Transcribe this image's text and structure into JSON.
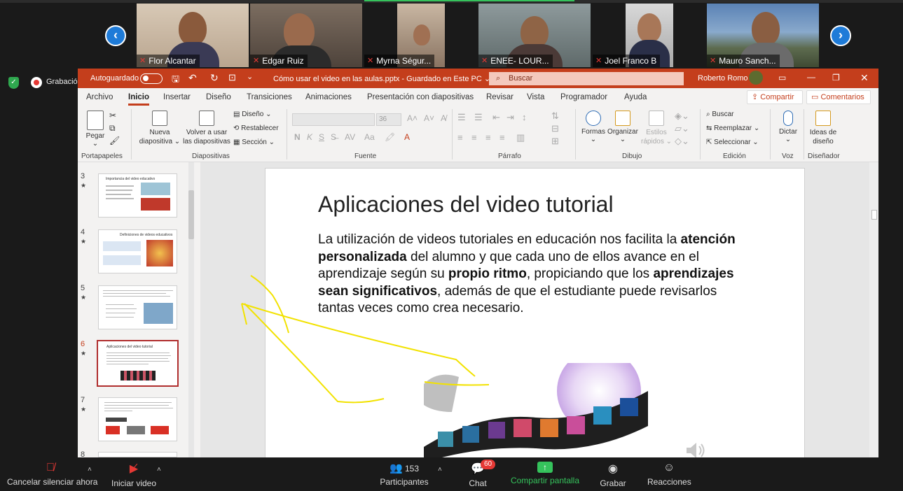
{
  "participants": [
    {
      "name": "Flor Alcantar"
    },
    {
      "name": "Edgar Ruiz"
    },
    {
      "name": "Myrna Ségur..."
    },
    {
      "name": "ENEE- LOUR..."
    },
    {
      "name": "Joel Franco B"
    },
    {
      "name": "Mauro Sanch..."
    }
  ],
  "recording_label": "Grabación",
  "ppt": {
    "autosave_label": "Autoguardado",
    "doc_title": "Cómo usar el video en las aulas.pptx  -  Guardado en Este PC ⌄",
    "search_placeholder": "Buscar",
    "user_name": "Roberto Romo",
    "menu_tabs": [
      "Archivo",
      "Inicio",
      "Insertar",
      "Diseño",
      "Transiciones",
      "Animaciones",
      "Presentación con diapositivas",
      "Revisar",
      "Vista",
      "Programador",
      "Ayuda"
    ],
    "share_label": "Compartir",
    "comments_label": "Comentarios",
    "ribbon": {
      "paste": "Pegar",
      "new_slide": "Nueva diapositiva ⌄",
      "reuse": "Volver a usar las diapositivas",
      "layout": "Diseño ⌄",
      "reset": "Restablecer",
      "section": "Sección ⌄",
      "font_size": "36",
      "shapes": "Formas",
      "arrange": "Organizar",
      "quick_styles": "Estilos rápidos ⌄",
      "find": "Buscar",
      "replace": "Reemplazar ⌄",
      "select": "Seleccionar ⌄",
      "dictate": "Dictar",
      "design_ideas": "Ideas de diseño",
      "groups": [
        "Portapapeles",
        "Diapositivas",
        "Fuente",
        "Párrafo",
        "Dibujo",
        "Edición",
        "Voz",
        "Diseñador"
      ]
    },
    "slides": [
      {
        "num": "3",
        "title": "Importancia del video educativo"
      },
      {
        "num": "4",
        "title": "Definiciones de videos educativos"
      },
      {
        "num": "5",
        "title": ""
      },
      {
        "num": "6",
        "title": "Aplicaciones del video tutorial"
      },
      {
        "num": "7",
        "title": ""
      },
      {
        "num": "8",
        "title": ""
      }
    ],
    "current_slide": {
      "title": "Aplicaciones del video tutorial",
      "t1": "La utilización de videos tutoriales en educación nos facilita la ",
      "b1": "atención personalizada",
      "t2": " del alumno y que cada uno de ellos avance en el aprendizaje según su ",
      "b2": "propio ritmo",
      "t3": ", propiciando que los ",
      "b3": "aprendizajes sean significativos",
      "t4": ", además de que el estudiante puede revisarlos tantas veces como crea necesario."
    }
  },
  "toolbar": {
    "mute_label": "Cancelar silenciar ahora",
    "video_label": "Iniciar video",
    "participants_label": "Participantes",
    "participants_count": "153",
    "chat_label": "Chat",
    "chat_badge": "60",
    "share_label": "Compartir pantalla",
    "record_label": "Grabar",
    "reactions_label": "Reacciones"
  },
  "colors": {
    "ppt_accent": "#c43e1c",
    "zoom_blue": "#1e7bd8",
    "share_green": "#35c35c",
    "annotation": "#f2e200"
  }
}
